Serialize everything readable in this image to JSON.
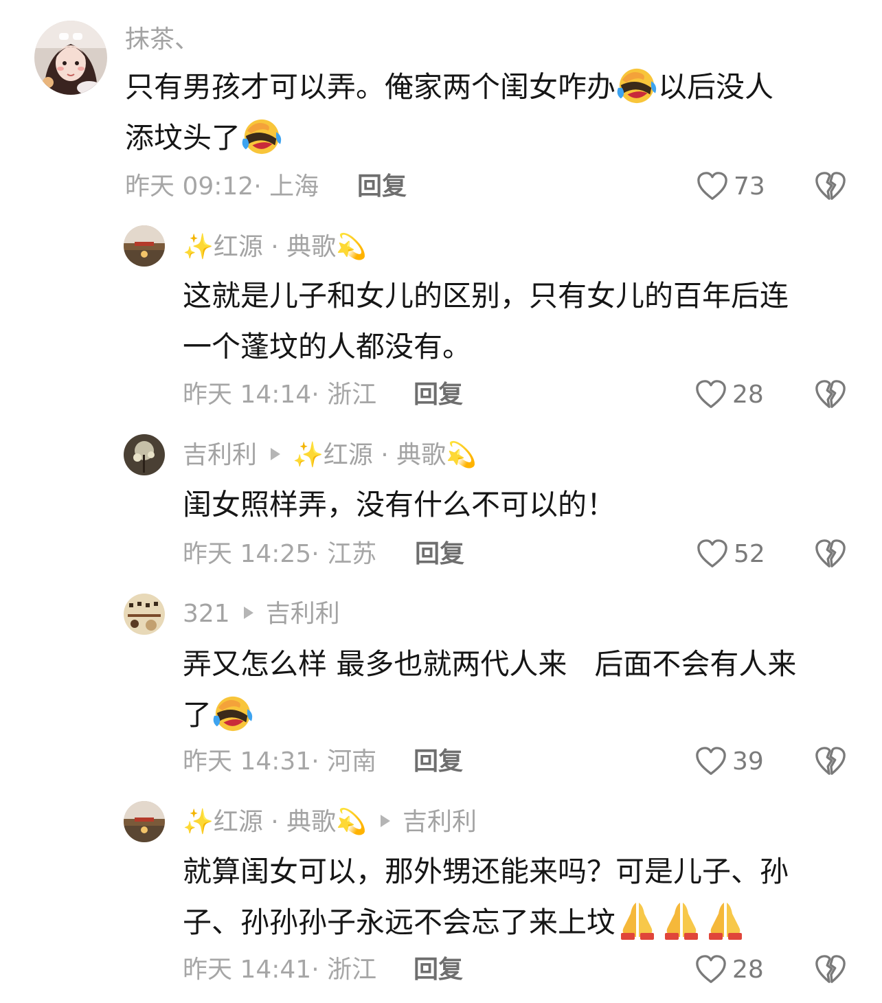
{
  "comments": [
    {
      "author": "抹茶、",
      "text_1": "只有男孩才可以弄。俺家两个闺女咋办",
      "text_2": "以后没人",
      "text_3": "添坟头了",
      "time": "昨天 09:12· 上海",
      "reply": "回复",
      "likes": "73"
    },
    {
      "author": "✨红源 · 典歌💫",
      "text_line1": "这就是儿子和女儿的区别，只有女儿的百年后连",
      "text_line2": "一个蓬坟的人都没有。",
      "time": "昨天 14:14· 浙江",
      "reply": "回复",
      "likes": "28"
    },
    {
      "author": "吉利利",
      "reply_to": "✨红源 · 典歌💫",
      "text": "闺女照样弄，没有什么不可以的！",
      "time": "昨天 14:25· 江苏",
      "reply": "回复",
      "likes": "52"
    },
    {
      "author": "321",
      "reply_to": "吉利利",
      "text_line1": "弄又怎么样 最多也就两代人来   后面不会有人来",
      "text_line2": "了",
      "time": "昨天 14:31· 河南",
      "reply": "回复",
      "likes": "39"
    },
    {
      "author": "✨红源 · 典歌💫",
      "reply_to": "吉利利",
      "text_line1": "就算闺女可以，那外甥还能来吗？可是儿子、孙",
      "text_line2": "子、孙孙孙子永远不会忘了来上坟",
      "time": "昨天 14:41· 浙江",
      "reply": "回复",
      "likes": "28"
    }
  ],
  "icons": {
    "like": "heart-outline-icon",
    "dislike": "broken-heart-icon",
    "laugh_cry": "laughing-crying-face-emoji",
    "pray": "folded-hands-emoji",
    "reply_arrow": "play-triangle-icon"
  }
}
